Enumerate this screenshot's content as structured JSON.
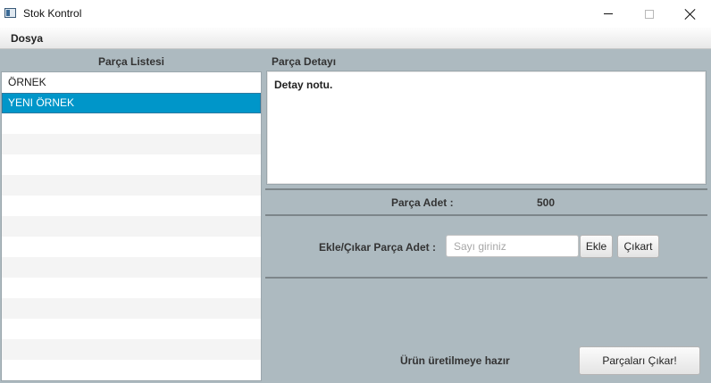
{
  "window": {
    "title": "Stok Kontrol",
    "icon": "app-window-icon"
  },
  "menu": {
    "items": [
      {
        "label": "Dosya"
      }
    ]
  },
  "parts_list": {
    "title": "Parça Listesi",
    "items": [
      {
        "label": "ÖRNEK",
        "selected": false
      },
      {
        "label": "YENI ÖRNEK",
        "selected": true
      }
    ]
  },
  "part_detail": {
    "title": "Parça Detayı",
    "note": "Detay notu."
  },
  "part_count": {
    "label": "Parça Adet :",
    "value": "500"
  },
  "add_remove": {
    "label": "Ekle/Çıkar Parça Adet :",
    "input_placeholder": "Sayı giriniz",
    "input_value": "",
    "add_label": "Ekle",
    "remove_label": "Çıkart"
  },
  "status": {
    "text": "Ürün üretilmeye hazır",
    "produce_label": "Parçaları Çıkar!"
  },
  "colors": {
    "panel_bg": "#adbac0",
    "selection": "#0096c9"
  }
}
